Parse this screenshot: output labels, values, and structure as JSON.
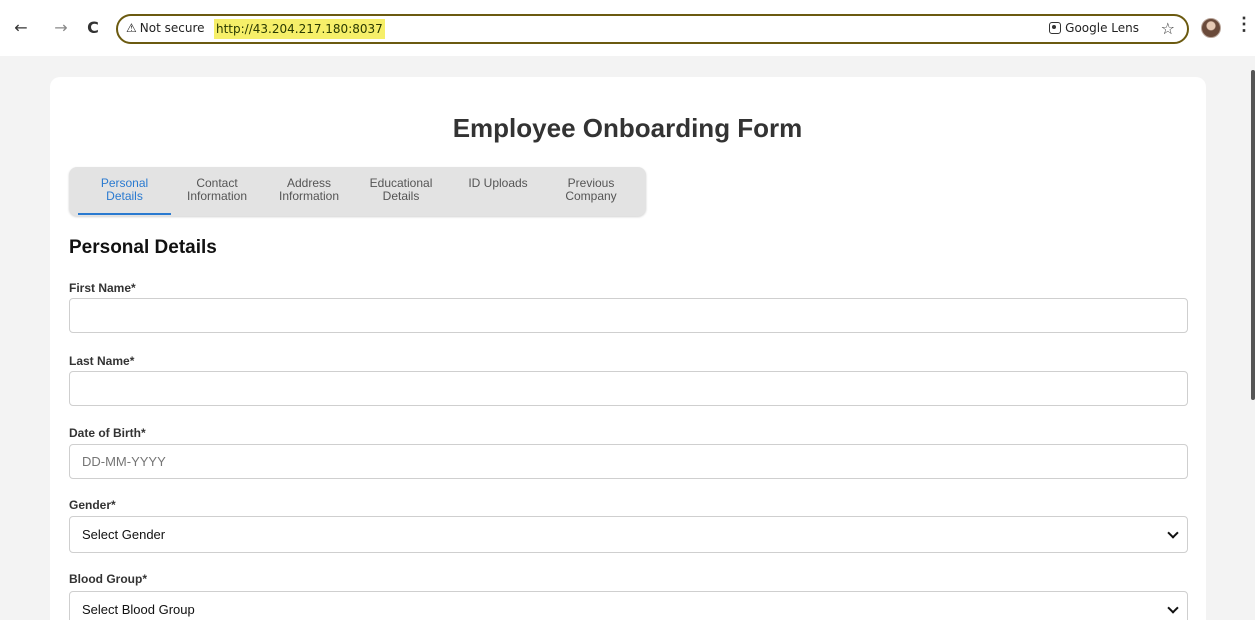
{
  "browser": {
    "back_icon": "←",
    "forward_icon": "→",
    "reload_icon": "C",
    "security_text": "Not secure",
    "url": "http://43.204.217.180:8037",
    "lens_label": "Google Lens",
    "star_icon": "☆",
    "menu_icon": "⋮"
  },
  "form": {
    "title": "Employee Onboarding Form",
    "tabs": [
      {
        "line1": "Personal",
        "line2": "Details",
        "active": true
      },
      {
        "line1": "Contact",
        "line2": "Information",
        "active": false
      },
      {
        "line1": "Address",
        "line2": "Information",
        "active": false
      },
      {
        "line1": "Educational",
        "line2": "Details",
        "active": false
      },
      {
        "line1": "ID Uploads",
        "line2": "",
        "active": false
      },
      {
        "line1": "Previous",
        "line2": "Company",
        "active": false
      }
    ],
    "section_title": "Personal Details",
    "fields": {
      "first_name": {
        "label": "First Name*",
        "value": "",
        "placeholder": ""
      },
      "last_name": {
        "label": "Last Name*",
        "value": "",
        "placeholder": ""
      },
      "dob": {
        "label": "Date of Birth*",
        "value": "",
        "placeholder": "DD-MM-YYYY"
      },
      "gender": {
        "label": "Gender*",
        "selected": "Select Gender"
      },
      "blood_group": {
        "label": "Blood Group*",
        "selected": "Select Blood Group"
      }
    }
  },
  "colors": {
    "accent": "#2a7ad0",
    "url_highlight": "#f6ef69"
  }
}
